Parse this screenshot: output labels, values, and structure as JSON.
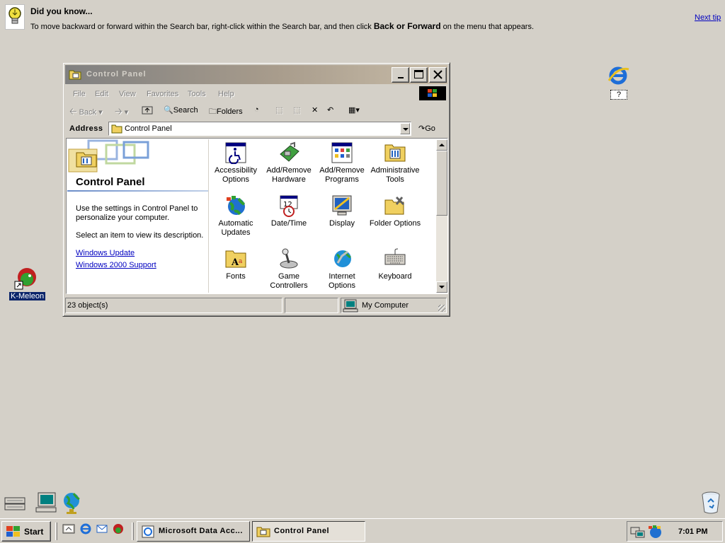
{
  "tip": {
    "title": "Did you know...",
    "text_before": "To move backward or forward within the Search bar, right-click within the Search bar, and then click ",
    "text_bold": "Back or Forward",
    "text_after": " on the menu that appears.",
    "next_tip": "Next tip"
  },
  "desktop": {
    "ie_label": "?",
    "kmeleon_label": "K-Meleon"
  },
  "window": {
    "title": "Control Panel",
    "menu": [
      "File",
      "Edit",
      "View",
      "Favorites",
      "Tools",
      "Help"
    ],
    "toolbar": {
      "back": "Back",
      "search": "Search",
      "folders": "Folders"
    },
    "address": {
      "label": "Address",
      "value": "Control Panel",
      "go": "Go"
    },
    "left_panel": {
      "title": "Control Panel",
      "description": "Use the settings in Control Panel to personalize your computer.",
      "hint": "Select an item to view its description.",
      "links": [
        "Windows Update",
        "Windows 2000 Support"
      ]
    },
    "items": [
      {
        "line1": "Accessibility",
        "line2": "Options"
      },
      {
        "line1": "Add/Remove",
        "line2": "Hardware"
      },
      {
        "line1": "Add/Remove",
        "line2": "Programs"
      },
      {
        "line1": "Administrative",
        "line2": "Tools"
      },
      {
        "line1": "Automatic",
        "line2": "Updates"
      },
      {
        "line1": "Date/Time",
        "line2": ""
      },
      {
        "line1": "Display",
        "line2": ""
      },
      {
        "line1": "Folder Options",
        "line2": ""
      },
      {
        "line1": "Fonts",
        "line2": ""
      },
      {
        "line1": "Game",
        "line2": "Controllers"
      },
      {
        "line1": "Internet",
        "line2": "Options"
      },
      {
        "line1": "Keyboard",
        "line2": ""
      }
    ],
    "status": {
      "objects": "23 object(s)",
      "zone": "My Computer"
    }
  },
  "taskbar": {
    "start": "Start",
    "tasks": [
      "Microsoft Data Acc...",
      "Control Panel"
    ],
    "clock": "7:01 PM"
  },
  "colors": {
    "desktop": "#d4d0c8",
    "link": "#0000c0",
    "inactive_title_start": "#808080",
    "inactive_title_end": "#c8bca8"
  }
}
